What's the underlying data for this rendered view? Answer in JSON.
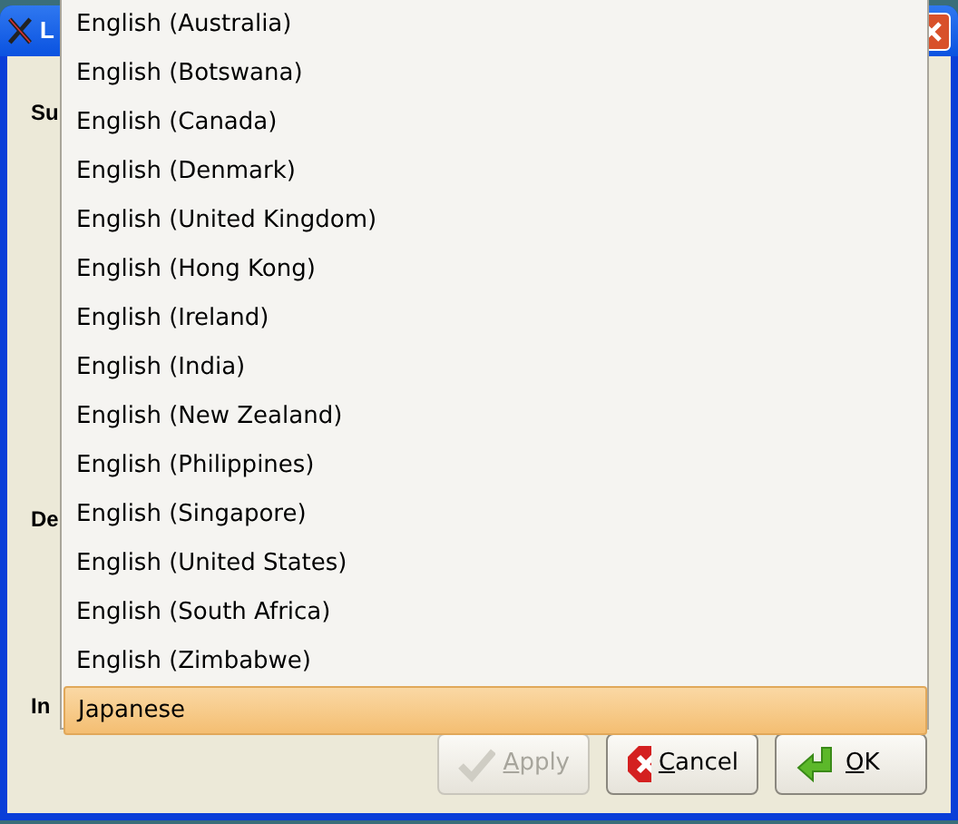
{
  "window": {
    "title": "L"
  },
  "labels": [
    {
      "text": "Su"
    },
    {
      "text": "De"
    },
    {
      "text": "In"
    }
  ],
  "dropdown": {
    "items": [
      {
        "label": "English (Australia)",
        "selected": false
      },
      {
        "label": "English (Botswana)",
        "selected": false
      },
      {
        "label": "English (Canada)",
        "selected": false
      },
      {
        "label": "English (Denmark)",
        "selected": false
      },
      {
        "label": "English (United Kingdom)",
        "selected": false
      },
      {
        "label": "English (Hong Kong)",
        "selected": false
      },
      {
        "label": "English (Ireland)",
        "selected": false
      },
      {
        "label": "English (India)",
        "selected": false
      },
      {
        "label": "English (New Zealand)",
        "selected": false
      },
      {
        "label": "English (Philippines)",
        "selected": false
      },
      {
        "label": "English (Singapore)",
        "selected": false
      },
      {
        "label": "English (United States)",
        "selected": false
      },
      {
        "label": "English (South Africa)",
        "selected": false
      },
      {
        "label": "English (Zimbabwe)",
        "selected": false
      },
      {
        "label": "Japanese",
        "selected": true
      }
    ]
  },
  "buttons": [
    {
      "kind": "apply",
      "label": "Apply",
      "disabled": true
    },
    {
      "kind": "cancel",
      "label": "Cancel",
      "disabled": false
    },
    {
      "kind": "ok",
      "label": "OK",
      "disabled": false
    }
  ]
}
